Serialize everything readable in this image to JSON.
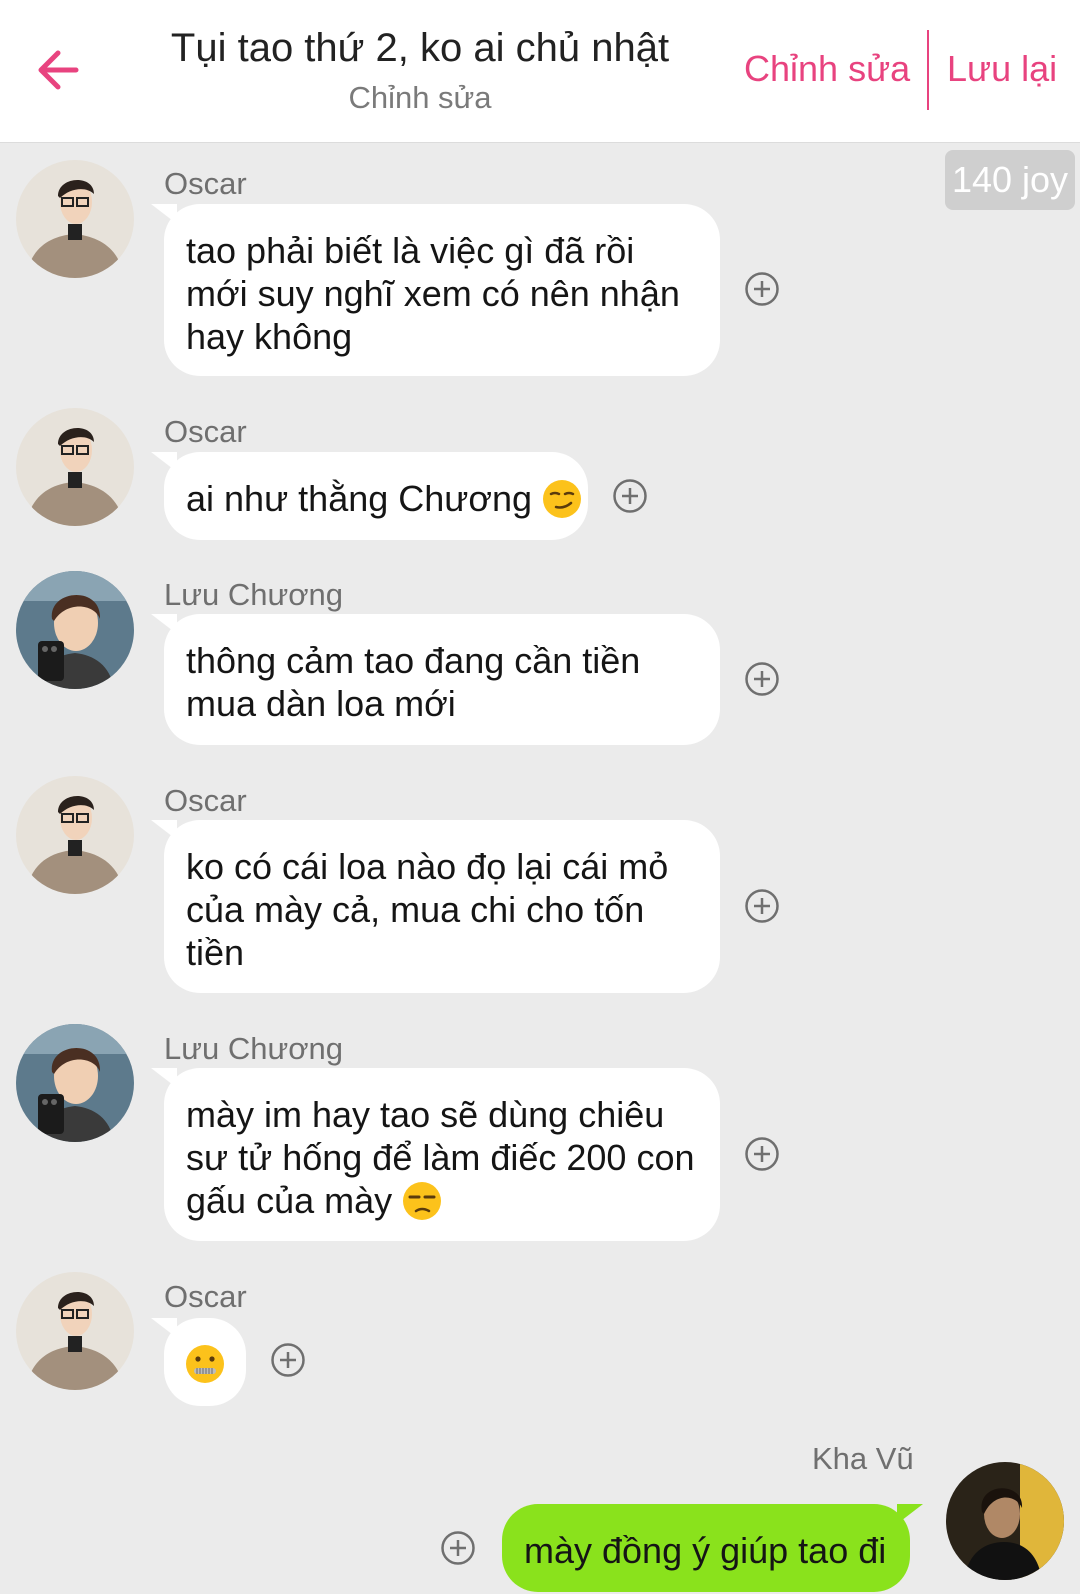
{
  "header": {
    "title": "Tụi tao thứ 2, ko ai chủ nhật",
    "subtitle": "Chỉnh sửa",
    "edit_label": "Chỉnh sửa",
    "save_label": "Lưu lại",
    "accent_color": "#e8437f"
  },
  "joy_badge": "140 joy",
  "messages": [
    {
      "sender": "Oscar",
      "text": "tao phải biết là việc gì đã rồi mới suy nghĩ xem có nên nhận hay không",
      "emoji": ""
    },
    {
      "sender": "Oscar",
      "text": "ai như thằng Chương",
      "emoji": "smirk"
    },
    {
      "sender": "Lưu Chương",
      "text": "thông cảm tao đang cần tiền mua dàn loa mới",
      "emoji": ""
    },
    {
      "sender": "Oscar",
      "text": "ko có cái loa nào đọ lại cái mỏ của mày cả, mua chi cho tốn tiền",
      "emoji": ""
    },
    {
      "sender": "Lưu Chương",
      "text": "mày im hay tao sẽ dùng chiêu sư tử hống để làm điếc 200 con gấu của mày",
      "emoji": "unamused"
    },
    {
      "sender": "Oscar",
      "text": "",
      "emoji": "zipper-mouth"
    },
    {
      "sender": "Kha Vũ",
      "text": "mày đồng ý giúp tao đi",
      "emoji": ""
    }
  ],
  "colors": {
    "sent_bubble": "#8ae21c",
    "received_bubble": "#ffffff",
    "background": "#ebebeb"
  }
}
